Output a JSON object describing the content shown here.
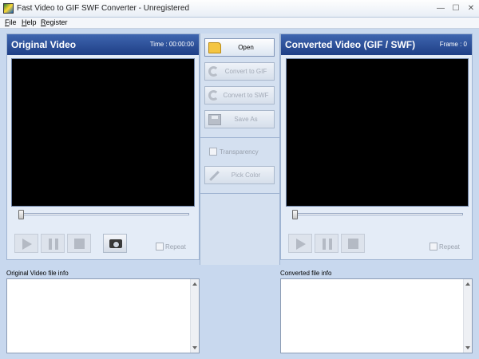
{
  "window": {
    "title": "Fast Video to GIF SWF Converter - Unregistered",
    "controls": {
      "minimize": "—",
      "maximize": "☐",
      "close": "✕"
    }
  },
  "menu": [
    {
      "label": "File"
    },
    {
      "label": "Help"
    },
    {
      "label": "Register"
    }
  ],
  "original": {
    "title": "Original Video",
    "meta": "Time : 00:00:00",
    "repeat_label": "Repeat",
    "info_label": "Original Video file info",
    "info_text": ""
  },
  "converted": {
    "title": "Converted Video (GIF / SWF)",
    "meta": "Frame : 0",
    "repeat_label": "Repeat",
    "info_label": "Converted file info",
    "info_text": ""
  },
  "actions": {
    "open": "Open",
    "convert_gif": "Convert to GIF",
    "convert_swf": "Convert to SWF",
    "save_as": "Save As",
    "transparency": "Transparency",
    "pick_color": "Pick Color"
  },
  "playback": {
    "position_original": 0,
    "position_converted": 0
  },
  "colors": {
    "header": "#1f3f86",
    "screen": "#000000",
    "background": "#c8d8ee"
  }
}
